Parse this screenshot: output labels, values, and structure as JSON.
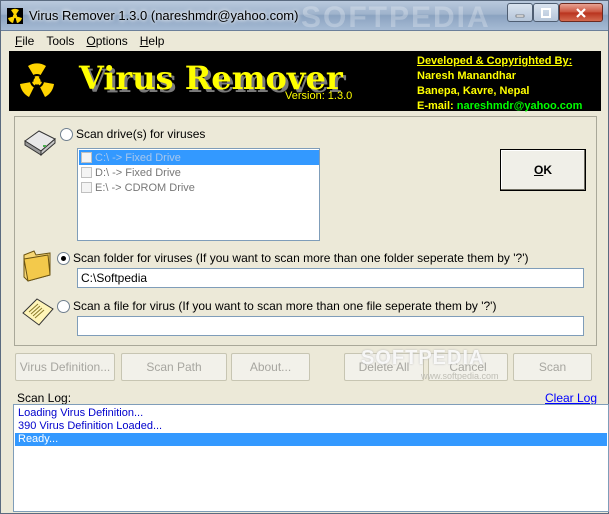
{
  "window": {
    "title": "Virus Remover 1.3.0     (nareshmdr@yahoo.com)",
    "watermark": "SOFTPEDIA"
  },
  "menu": {
    "items": [
      {
        "label": "File",
        "key": "F",
        "rest": "ile"
      },
      {
        "label": "Tools",
        "key": "",
        "rest": "Tools"
      },
      {
        "label": "Options",
        "key": "O",
        "rest": "ptions"
      },
      {
        "label": "Help",
        "key": "H",
        "rest": "elp"
      }
    ]
  },
  "banner": {
    "title": "Virus Remover",
    "version": "Version: 1.3.0",
    "developed_by": "Developed & Copyrighted By:",
    "author": "Naresh Manandhar",
    "address": "Banepa, Kavre, Nepal",
    "email_label": "E-mail:",
    "email": "nareshmdr@yahoo.com",
    "colors": {
      "background": "#000000",
      "text": "#ffff00",
      "email": "#00ff00"
    }
  },
  "scan": {
    "drives_label": "Scan drive(s) for viruses",
    "drives": [
      {
        "label": "C:\\ -> Fixed Drive",
        "checked": false,
        "selected": true
      },
      {
        "label": "D:\\ -> Fixed Drive",
        "checked": false,
        "selected": false
      },
      {
        "label": "E:\\ -> CDROM Drive",
        "checked": false,
        "selected": false
      }
    ],
    "ok_key": "O",
    "ok_rest": "K",
    "folder_label": "Scan folder for viruses (If you want to scan more than one folder seperate them by '?')",
    "folder_value": "C:\\Softpedia",
    "file_label": "Scan a file for virus (If you want to scan more than one file seperate them by '?')",
    "file_value": "",
    "selected_mode": "folder"
  },
  "buttons": {
    "virus_definition": "Virus Definition...",
    "scan_path": "Scan Path",
    "about": "About...",
    "delete_all": "Delete All",
    "cancel": "Cancel",
    "scan": "Scan"
  },
  "watermark": {
    "text": "SOFTPEDIA",
    "url": "www.softpedia.com"
  },
  "log": {
    "label": "Scan Log:",
    "clear": "Clear Log",
    "lines": [
      "Loading Virus Definition...",
      "390 Virus Definition Loaded...",
      "Ready..."
    ],
    "selected_index": 2
  }
}
